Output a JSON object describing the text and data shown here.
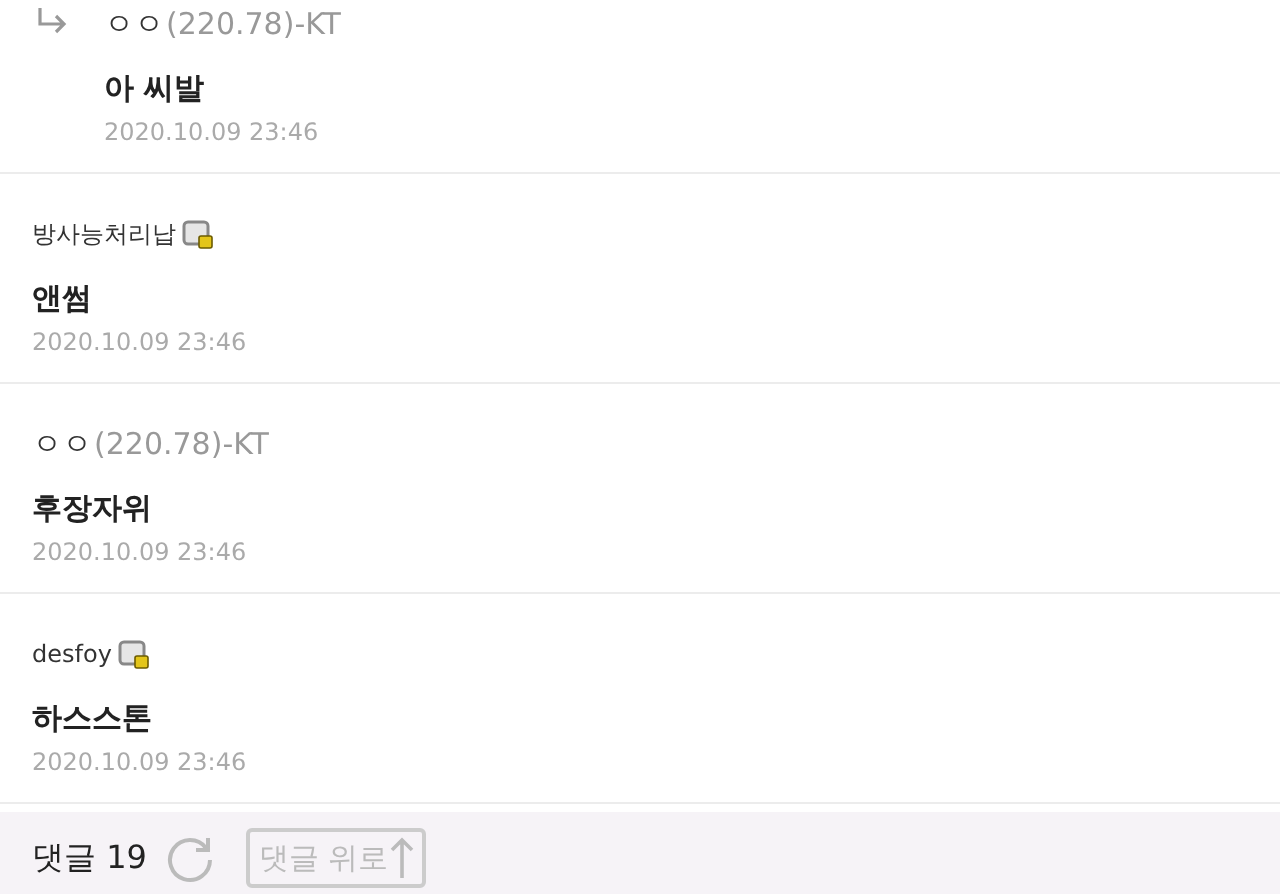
{
  "comments": [
    {
      "kind": "reply",
      "nick": "ㅇㅇ",
      "ip": "(220.78)-KT",
      "member": false,
      "text": "아 씨발",
      "date": "2020.10.09 23:46"
    },
    {
      "kind": "comment",
      "nick": "방사능처리납",
      "member": true,
      "text": "앤썸",
      "date": "2020.10.09 23:46"
    },
    {
      "kind": "comment",
      "nick": "ㅇㅇ",
      "ip": "(220.78)-KT",
      "member": false,
      "text": "후장자위",
      "date": "2020.10.09 23:46"
    },
    {
      "kind": "comment",
      "nick": "desfoy",
      "member": true,
      "text": "하스스톤",
      "date": "2020.10.09 23:46"
    }
  ],
  "footer": {
    "label": "댓글",
    "count": "19",
    "top_button": "댓글 위로"
  }
}
